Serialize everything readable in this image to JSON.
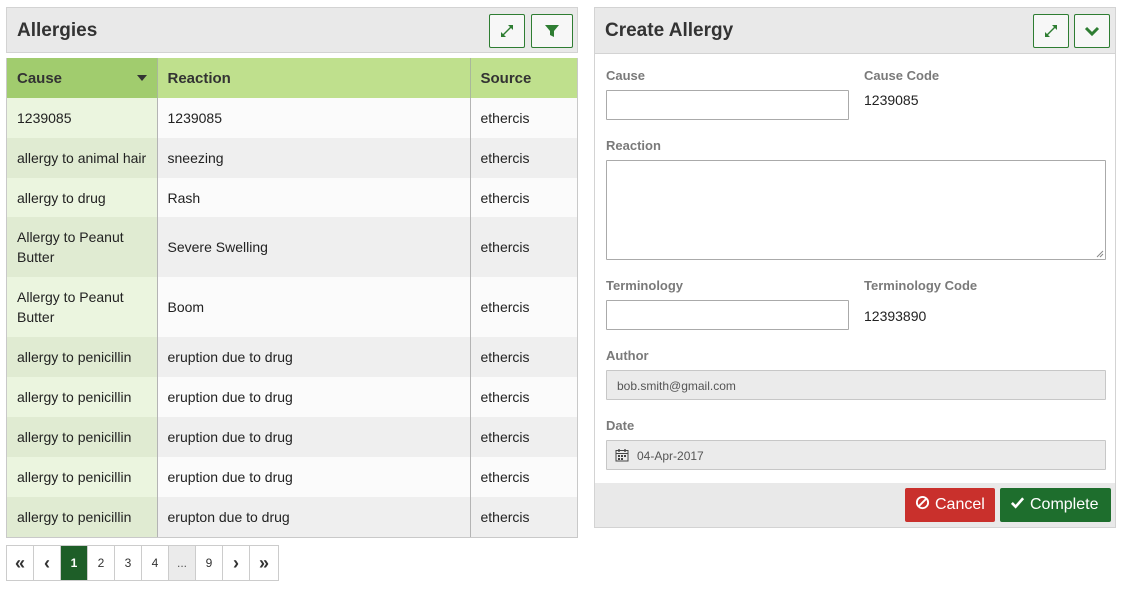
{
  "allergies_panel": {
    "title": "Allergies",
    "expand_icon": "expand-icon",
    "filter_icon": "filter-icon"
  },
  "table": {
    "columns": [
      "Cause",
      "Reaction",
      "Source"
    ],
    "rows": [
      {
        "cause": "1239085",
        "reaction": "1239085",
        "source": "ethercis"
      },
      {
        "cause": "allergy to animal hair",
        "reaction": "sneezing",
        "source": "ethercis"
      },
      {
        "cause": "allergy to drug",
        "reaction": "Rash",
        "source": "ethercis"
      },
      {
        "cause": "Allergy to Peanut Butter",
        "reaction": "Severe Swelling",
        "source": "ethercis"
      },
      {
        "cause": "Allergy to Peanut Butter",
        "reaction": "Boom",
        "source": "ethercis"
      },
      {
        "cause": "allergy to penicillin",
        "reaction": "eruption due to drug",
        "source": "ethercis"
      },
      {
        "cause": "allergy to penicillin",
        "reaction": "eruption due to drug",
        "source": "ethercis"
      },
      {
        "cause": "allergy to penicillin",
        "reaction": "eruption due to drug",
        "source": "ethercis"
      },
      {
        "cause": "allergy to penicillin",
        "reaction": "eruption due to drug",
        "source": "ethercis"
      },
      {
        "cause": "allergy to penicillin",
        "reaction": "erupton due to drug",
        "source": "ethercis"
      }
    ]
  },
  "pagination": {
    "first": "«",
    "prev": "‹",
    "pages": [
      "1",
      "2",
      "3",
      "4",
      "...",
      "9"
    ],
    "next": "›",
    "last": "»",
    "current": "1"
  },
  "create_panel": {
    "title": "Create Allergy",
    "expand_icon": "expand-icon",
    "collapse_icon": "chevron-down-icon",
    "cause_label": "Cause",
    "cause_value": "",
    "cause_code_label": "Cause Code",
    "cause_code_value": "1239085",
    "reaction_label": "Reaction",
    "reaction_value": "",
    "terminology_label": "Terminology",
    "terminology_value": "",
    "terminology_code_label": "Terminology Code",
    "terminology_code_value": "12393890",
    "author_label": "Author",
    "author_value": "bob.smith@gmail.com",
    "date_label": "Date",
    "date_value": "04-Apr-2017",
    "cancel_label": "Cancel",
    "complete_label": "Complete"
  },
  "colors": {
    "header_green": "#bfe08d",
    "sorted_header_green": "#a1cc6e",
    "primary_dark_green": "#1e5e28",
    "cancel_red": "#c9302c",
    "complete_green": "#1e6e2d"
  }
}
